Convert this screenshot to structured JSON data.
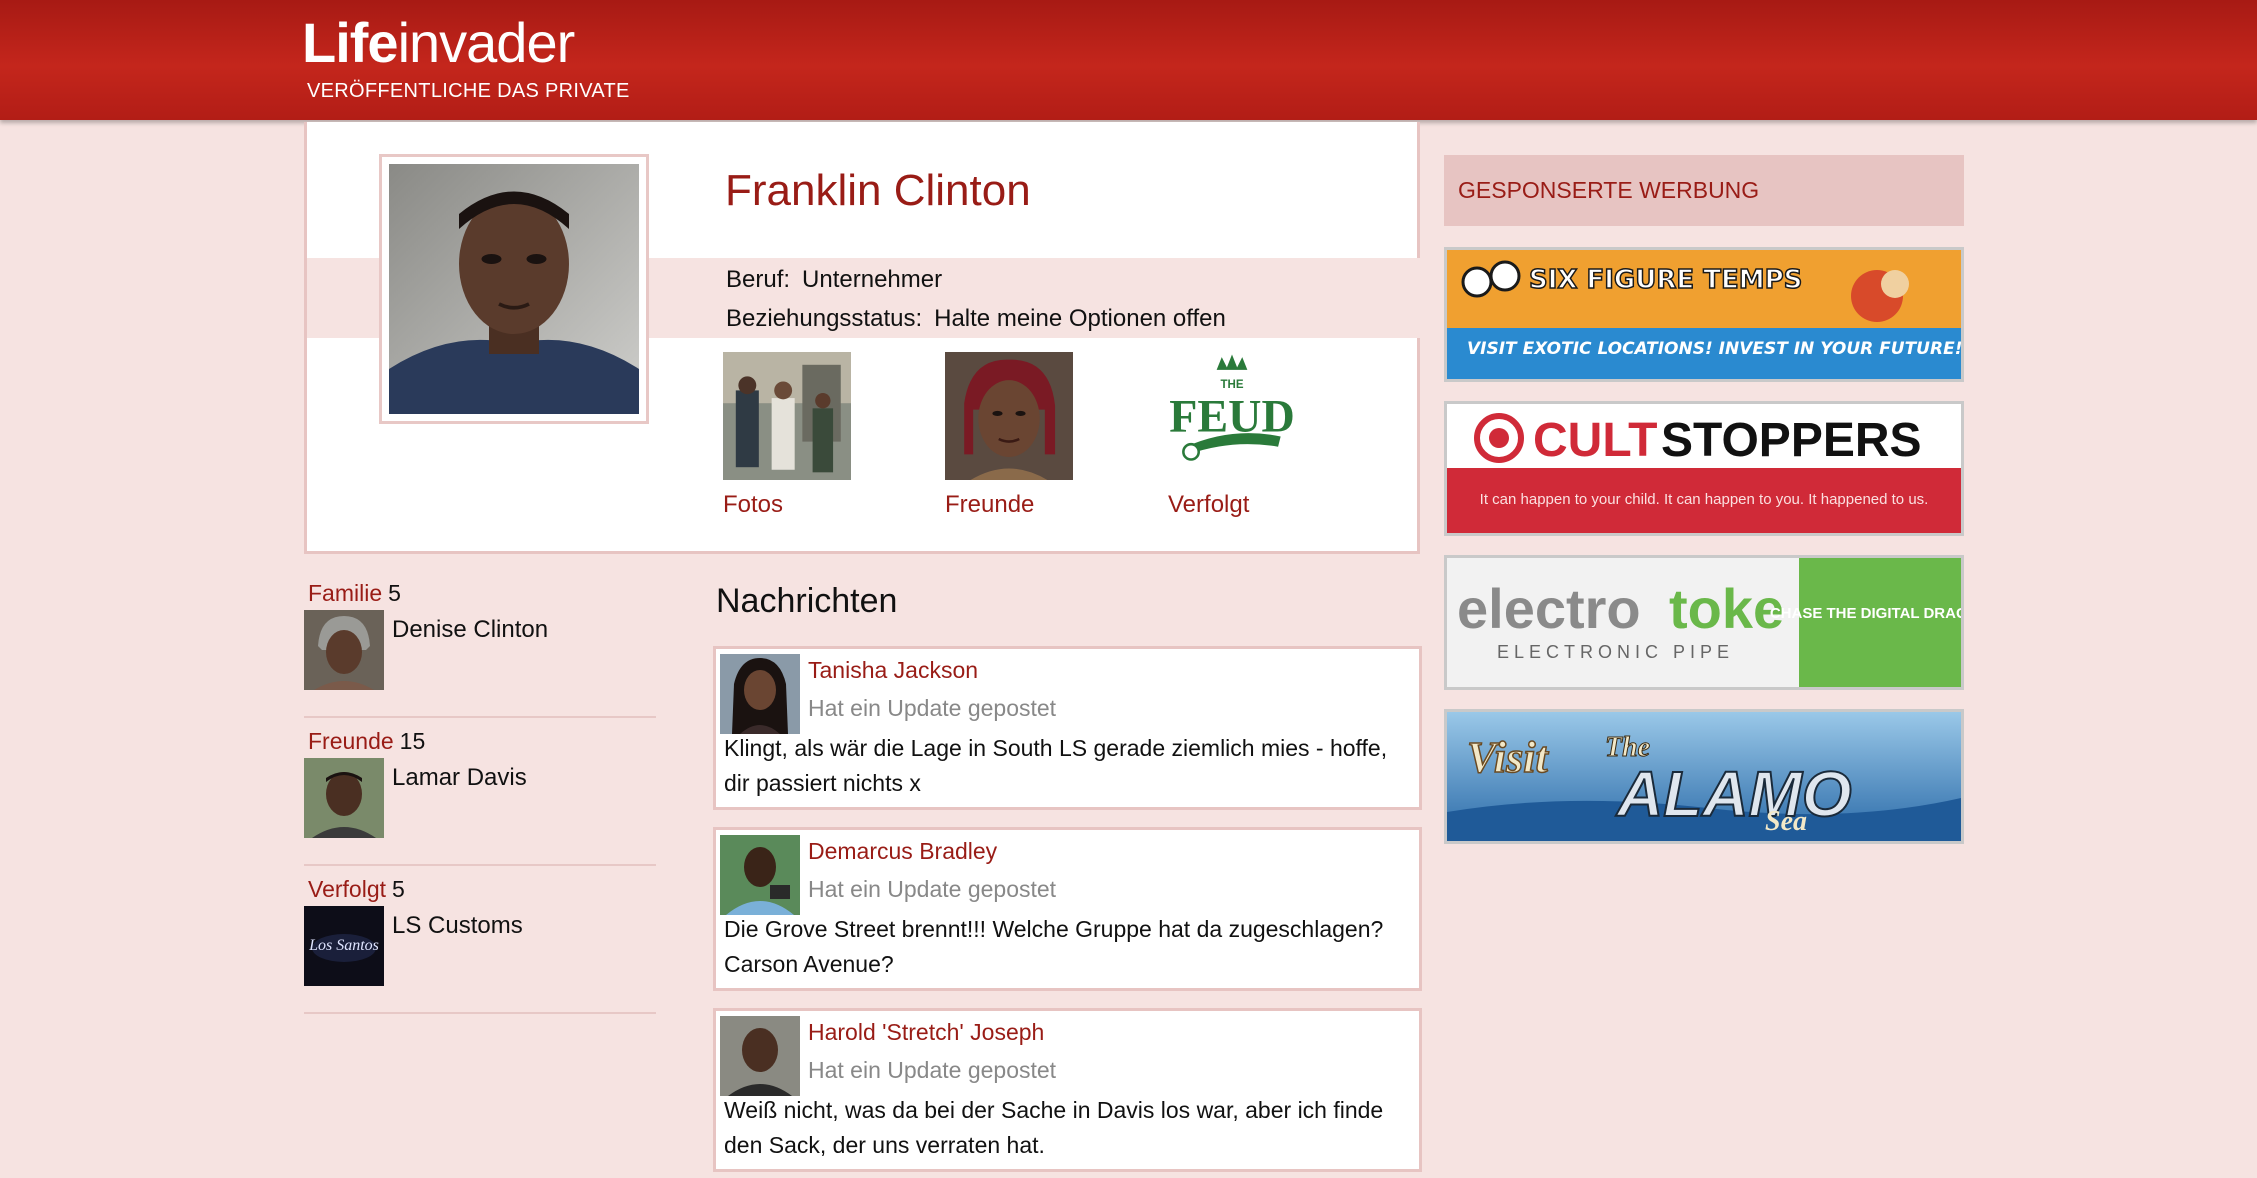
{
  "header": {
    "logo_bold": "Life",
    "logo_light": "invader",
    "tagline": "VERÖFFENTLICHE DAS PRIVATE"
  },
  "profile": {
    "name": "Franklin Clinton",
    "job_label": "Beruf:",
    "job_value": "Unternehmer",
    "relationship_label": "Beziehungsstatus:",
    "relationship_value": "Halte meine Optionen offen",
    "tiles": [
      {
        "label": "Fotos"
      },
      {
        "label": "Freunde"
      },
      {
        "label": "Verfolgt"
      }
    ]
  },
  "groups": [
    {
      "title": "Familie",
      "count": "5",
      "member": "Denise Clinton"
    },
    {
      "title": "Freunde",
      "count": "15",
      "member": "Lamar Davis"
    },
    {
      "title": "Verfolgt",
      "count": "5",
      "member": "LS Customs"
    }
  ],
  "messages": {
    "title": "Nachrichten",
    "items": [
      {
        "author": "Tanisha Jackson",
        "sub": "Hat ein Update gepostet",
        "text": "Klingt, als wär die Lage in South LS gerade ziemlich mies - hoffe, dir passiert nichts x"
      },
      {
        "author": "Demarcus Bradley",
        "sub": "Hat ein Update gepostet",
        "text": "Die Grove Street brennt!!! Welche Gruppe hat da zugeschlagen? Carson Avenue?"
      },
      {
        "author": "Harold 'Stretch' Joseph",
        "sub": "Hat ein Update gepostet",
        "text": "Weiß nicht, was da bei der Sache in Davis los war, aber ich finde den Sack, der uns verraten hat."
      }
    ]
  },
  "sponsored": {
    "title": "GESPONSERTE WERBUNG",
    "ads": [
      {
        "line1": "SIX FIGURE TEMPS",
        "line2": "VISIT EXOTIC LOCATIONS! INVEST IN YOUR FUTURE!"
      },
      {
        "line1_a": "CULT",
        "line1_b": "STOPPERS",
        "line2": "It can happen to your child. It can happen to you. It happened to us."
      },
      {
        "brand_a": "electro",
        "brand_b": "toke",
        "line2": "ELECTRONIC PIPE",
        "side": "CHASE THE DIGITAL DRAGON"
      },
      {
        "visit": "Visit",
        "the": "The",
        "main": "ALAMO",
        "sea": "Sea"
      }
    ]
  },
  "colors": {
    "brand_red": "#c4261c",
    "link": "#991c16",
    "bg": "#f6e3e1",
    "border": "#e7c4c2"
  }
}
